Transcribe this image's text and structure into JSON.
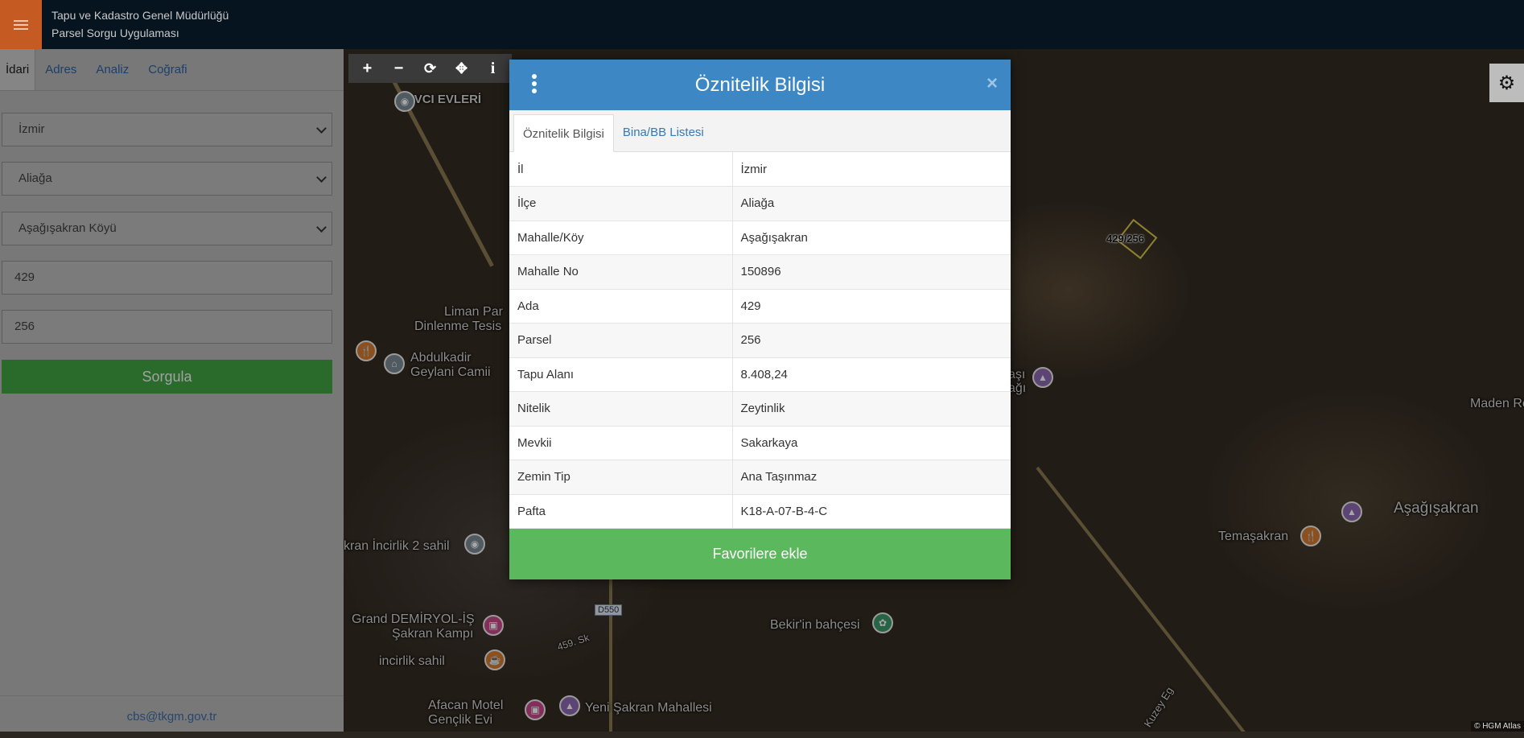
{
  "header": {
    "org_line1": "Tapu ve Kadastro Genel Müdürlüğü",
    "org_line2": "Parsel Sorgu Uygulaması"
  },
  "sidebar": {
    "tabs": [
      {
        "label": "İdari",
        "active": true
      },
      {
        "label": "Adres"
      },
      {
        "label": "Analiz"
      },
      {
        "label": "Coğrafi"
      }
    ],
    "il": "İzmir",
    "ilce": "Aliağa",
    "mahalle": "Aşağışakran Köyü",
    "ada": "429",
    "parsel": "256",
    "query_button": "Sorgula",
    "footer_email": "cbs@tkgm.gov.tr"
  },
  "map": {
    "tools": [
      "plus-icon",
      "minus-icon",
      "refresh-icon",
      "locate-icon",
      "info-icon"
    ],
    "labels": {
      "avci": "AVCI EVLERİ",
      "liman": "Liman Par",
      "dinlenme": "Dinlenme Tesis",
      "abdulkadir": "Abdulkadir",
      "geylani": "Geylani Camii",
      "incirlik2": "krаn İncirlik 2 sahil",
      "grand": "Grand DEMİRYOL-İŞ",
      "sakran": "Şakran Kampı",
      "incirlik_sahil": "incirlik sahil",
      "afacan": "Afacan Motel",
      "genclik": "Gençlik Evi",
      "yeni_sakran": "Yeni Şakran Mahallesi",
      "bekir": "Bekir'in bahçesi",
      "temasakran": "Temaşakran",
      "asagisakran": "Aşağışakran",
      "maden": "Maden Re",
      "asi": "aşı",
      "agi": "ağı",
      "road_459": "459. Sk",
      "d550": "D550",
      "kuzey": "Kuzey Eg",
      "parcel": "429/256",
      "attribution": "© HGM Atlas"
    }
  },
  "modal": {
    "title": "Öznitelik Bilgisi",
    "tabs": [
      {
        "label": "Öznitelik Bilgisi",
        "active": true
      },
      {
        "label": "Bina/BB Listesi"
      }
    ],
    "rows": [
      {
        "key": "İl",
        "value": "İzmir"
      },
      {
        "key": "İlçe",
        "value": "Aliağa"
      },
      {
        "key": "Mahalle/Köy",
        "value": "Aşağışakran"
      },
      {
        "key": "Mahalle No",
        "value": "150896"
      },
      {
        "key": "Ada",
        "value": "429"
      },
      {
        "key": "Parsel",
        "value": "256"
      },
      {
        "key": "Tapu Alanı",
        "value": "8.408,24"
      },
      {
        "key": "Nitelik",
        "value": "Zeytinlik"
      },
      {
        "key": "Mevkii",
        "value": "Sakarkaya"
      },
      {
        "key": "Zemin Tip",
        "value": "Ana Taşınmaz"
      },
      {
        "key": "Pafta",
        "value": "K18-A-07-B-4-C"
      }
    ],
    "favorite_button": "Favorilere ekle"
  }
}
